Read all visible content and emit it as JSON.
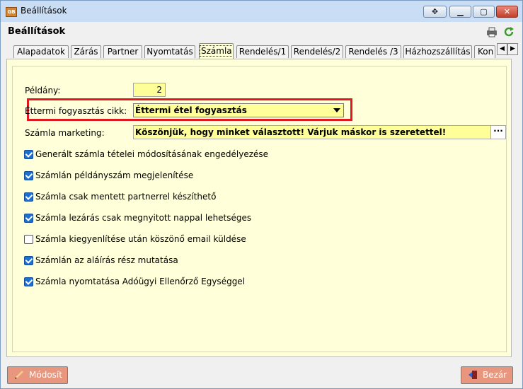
{
  "window": {
    "app_icon_text": "GB",
    "title": "Beállítások",
    "icons": [
      "move-icon",
      "minimize-icon",
      "maximize-icon",
      "close-icon"
    ]
  },
  "header": {
    "title": "Beállítások",
    "icons": [
      "print-icon",
      "refresh-icon"
    ]
  },
  "tabs": [
    {
      "label": "Alapadatok",
      "active": false
    },
    {
      "label": "Zárás",
      "active": false
    },
    {
      "label": "Partner",
      "active": false
    },
    {
      "label": "Nyomtatás",
      "active": false
    },
    {
      "label": "Számla",
      "active": true
    },
    {
      "label": "Rendelés/1",
      "active": false
    },
    {
      "label": "Rendelés/2",
      "active": false
    },
    {
      "label": "Rendelés /3",
      "active": false
    },
    {
      "label": "Házhozszállítás",
      "active": false
    },
    {
      "label": "Kon",
      "active": false
    }
  ],
  "form": {
    "peldany_label": "Példány:",
    "peldany_value": "2",
    "ettermi_label": "Éttermi fogyasztás cikk:",
    "ettermi_value": "Éttermi étel fogyasztás",
    "marketing_label": "Számla marketing:",
    "marketing_value": "Köszönjük, hogy minket választott! Várjuk máskor is szeretettel!",
    "marketing_button": "···"
  },
  "checkboxes": [
    {
      "label": "Generált számla tételei módosításának engedélyezése",
      "checked": true
    },
    {
      "label": "Számlán példányszám megjelenítése",
      "checked": true
    },
    {
      "label": "Számla csak mentett partnerrel készíthető",
      "checked": true
    },
    {
      "label": "Számla lezárás csak megnyitott nappal lehetséges",
      "checked": true
    },
    {
      "label": "Számla kiegyenlítése után köszönő email küldése",
      "checked": false
    },
    {
      "label": "Számlán az aláírás rész mutatása",
      "checked": true
    },
    {
      "label": "Számla nyomtatása Adóügyi Ellenőrző Egységgel",
      "checked": true
    }
  ],
  "footer": {
    "modify_label": "Módosít",
    "close_label": "Bezár"
  },
  "colors": {
    "panel_bg": "#ffffd9",
    "field_bg": "#ffff99",
    "highlight_border": "#e0181f",
    "footer_button": "#e8967e",
    "checkbox_checked": "#1c6fd1"
  }
}
